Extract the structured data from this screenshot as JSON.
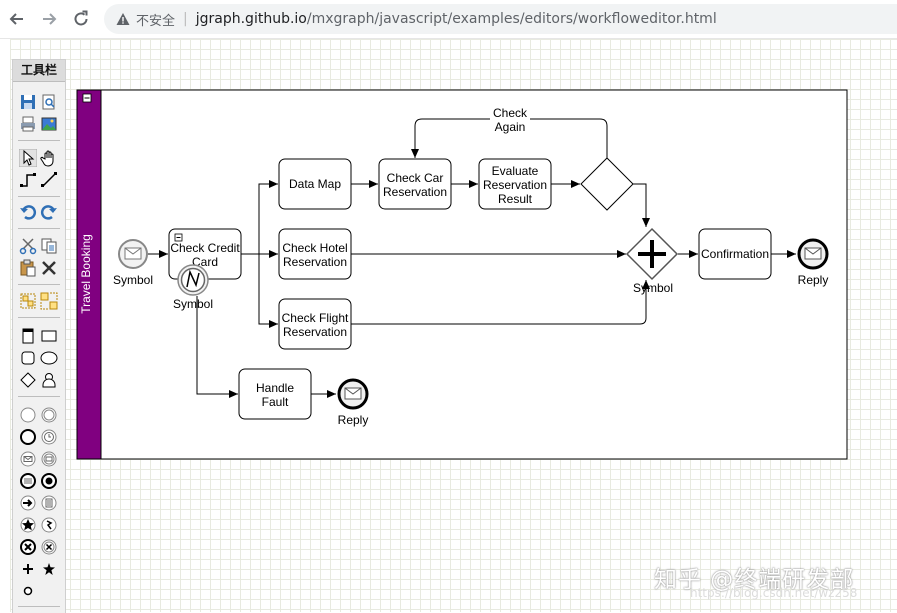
{
  "browser": {
    "back_icon": "arrow-left-icon",
    "forward_icon": "arrow-right-icon",
    "reload_icon": "reload-icon",
    "insecure_label": "不安全",
    "separator": "|",
    "url_host": "jgraph.github.io",
    "url_path": "/mxgraph/javascript/examples/editors/workfloweditor.html"
  },
  "toolbar": {
    "title": "工具栏",
    "icons": [
      "save-icon",
      "preview-icon",
      "print-icon",
      "export-image-icon",
      "select-pointer-icon",
      "pan-hand-icon",
      "connector-elbow-icon",
      "connector-straight-icon",
      "undo-icon",
      "redo-icon",
      "cut-icon",
      "copy-icon",
      "paste-icon",
      "delete-icon",
      "group-icon",
      "ungroup-icon",
      "swimlane-icon",
      "rectangle-icon",
      "rounded-rectangle-icon",
      "ellipse-icon",
      "rhombus-icon",
      "actor-icon",
      "event-start-icon",
      "event-double-icon",
      "event-end-icon",
      "timer-event-icon",
      "message-event-icon",
      "message-intermediate-icon",
      "terminate-event-icon",
      "error-event-icon",
      "link-event-icon",
      "rule-event-icon",
      "multiple-event-icon",
      "compensation-event-icon",
      "cancel-event-icon",
      "cross-event-icon",
      "plus-icon",
      "star-icon",
      "small-circle-icon"
    ]
  },
  "diagram": {
    "pool_label": "Travel Booking",
    "nodes": {
      "start": "Symbol",
      "check_credit": "Check Credit Card",
      "error_symbol": "Symbol",
      "data_map": "Data Map",
      "check_hotel": "Check Hotel Reservation",
      "check_flight": "Check Flight Reservation",
      "check_car": "Check Car Reservation",
      "evaluate": "Evaluate Reservation Result",
      "check_again": "Check Again",
      "join_symbol": "Symbol",
      "confirmation": "Confirmation",
      "reply_end": "Reply",
      "handle_fault": "Handle Fault",
      "fault_reply": "Reply"
    }
  },
  "watermark": {
    "text": "知乎 @终端研发部",
    "sub": "https://blog.csdn.net/wz258"
  },
  "colors": {
    "pool_header": "#800080",
    "grid": "#e8eae0",
    "toolbar_bg": "#f1f1f1"
  }
}
